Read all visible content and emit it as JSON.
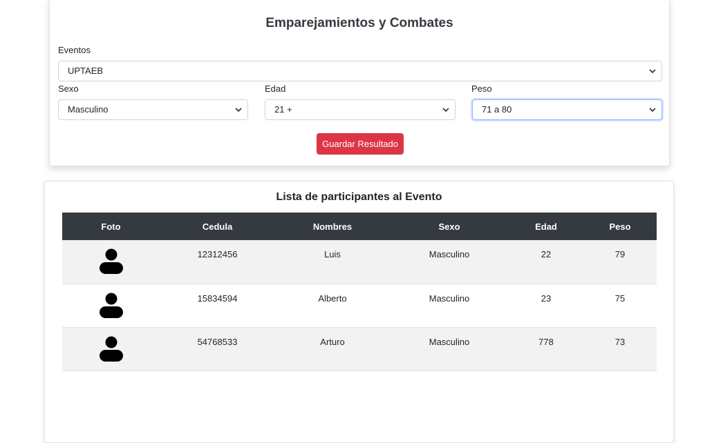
{
  "form": {
    "title": "Emparejamientos y Combates",
    "eventos_label": "Eventos",
    "eventos_value": "UPTAEB",
    "sexo_label": "Sexo",
    "sexo_value": "Masculino",
    "edad_label": "Edad",
    "edad_value": "21 +",
    "peso_label": "Peso",
    "peso_value": "71 a 80",
    "save_label": "Guardar Resultado"
  },
  "list": {
    "title": "Lista de participantes al Evento",
    "headers": [
      "Foto",
      "Cedula",
      "Nombres",
      "Sexo",
      "Edad",
      "Peso"
    ],
    "rows": [
      {
        "cedula": "12312456",
        "nombre": "Luis",
        "sexo": "Masculino",
        "edad": "22",
        "peso": "79"
      },
      {
        "cedula": "15834594",
        "nombre": "Alberto",
        "sexo": "Masculino",
        "edad": "23",
        "peso": "75"
      },
      {
        "cedula": "54768533",
        "nombre": "Arturo",
        "sexo": "Masculino",
        "edad": "778",
        "peso": "73"
      }
    ]
  },
  "colors": {
    "header_bg": "#343a40",
    "save_button": "#dc3545",
    "focus_border": "#86b7fe"
  },
  "icons": {
    "avatar": "person-icon",
    "select_caret": "chevron-down-icon"
  }
}
